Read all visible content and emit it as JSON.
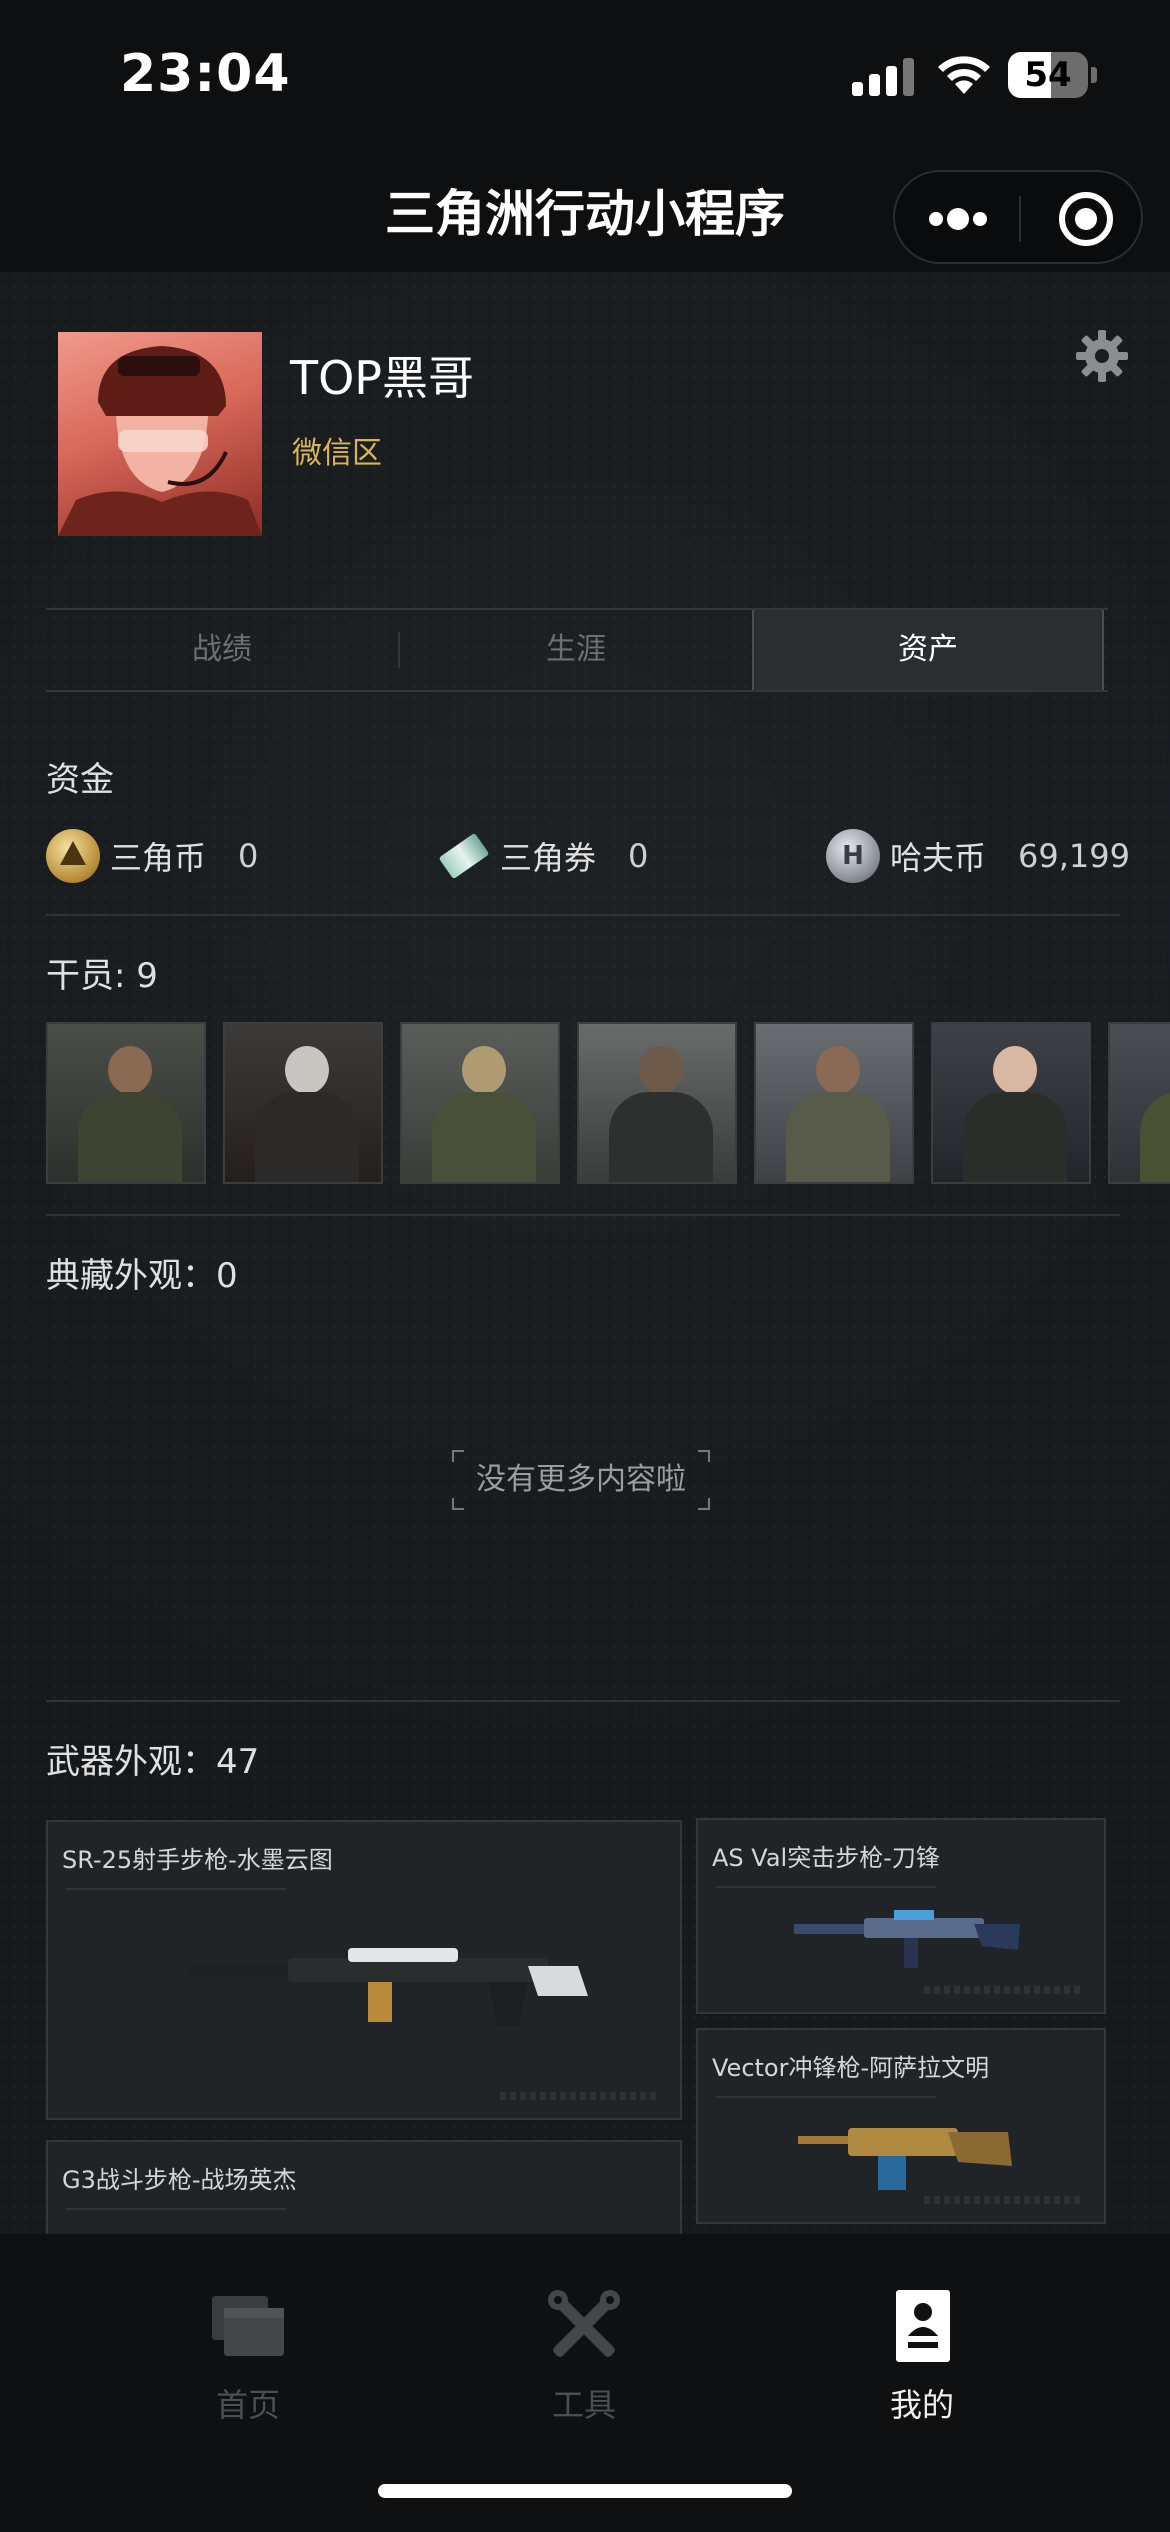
{
  "status_bar": {
    "time": "23:04",
    "battery": "54",
    "battery_level": 0.54
  },
  "nav": {
    "title": "三角洲行动小程序"
  },
  "profile": {
    "name": "TOP黑哥",
    "region": "微信区"
  },
  "tabs": [
    {
      "label": "战绩",
      "active": false
    },
    {
      "label": "生涯",
      "active": false
    },
    {
      "label": "资产",
      "active": true
    }
  ],
  "funds": {
    "title": "资金",
    "items": [
      {
        "label": "三角币",
        "value": "0",
        "icon": "triangle-coin-icon"
      },
      {
        "label": "三角券",
        "value": "0",
        "icon": "triangle-ticket-icon"
      },
      {
        "label": "哈夫币",
        "value": "69,199",
        "icon": "havoc-coin-icon"
      }
    ]
  },
  "agents": {
    "title": "干员: 9"
  },
  "collection": {
    "title": "典藏外观：0",
    "empty_text": "没有更多内容啦"
  },
  "weapons": {
    "title": "武器外观：47",
    "items": [
      {
        "name": "SR-25射手步枪-水墨云图"
      },
      {
        "name": "AS Val突击步枪-刀锋"
      },
      {
        "name": "Vector冲锋枪-阿萨拉文明"
      },
      {
        "name": "G3战斗步枪-战场英杰"
      }
    ]
  },
  "tabbar": [
    {
      "label": "首页",
      "icon": "home-icon",
      "active": false
    },
    {
      "label": "工具",
      "icon": "tools-icon",
      "active": false
    },
    {
      "label": "我的",
      "icon": "profile-icon",
      "active": true
    }
  ]
}
